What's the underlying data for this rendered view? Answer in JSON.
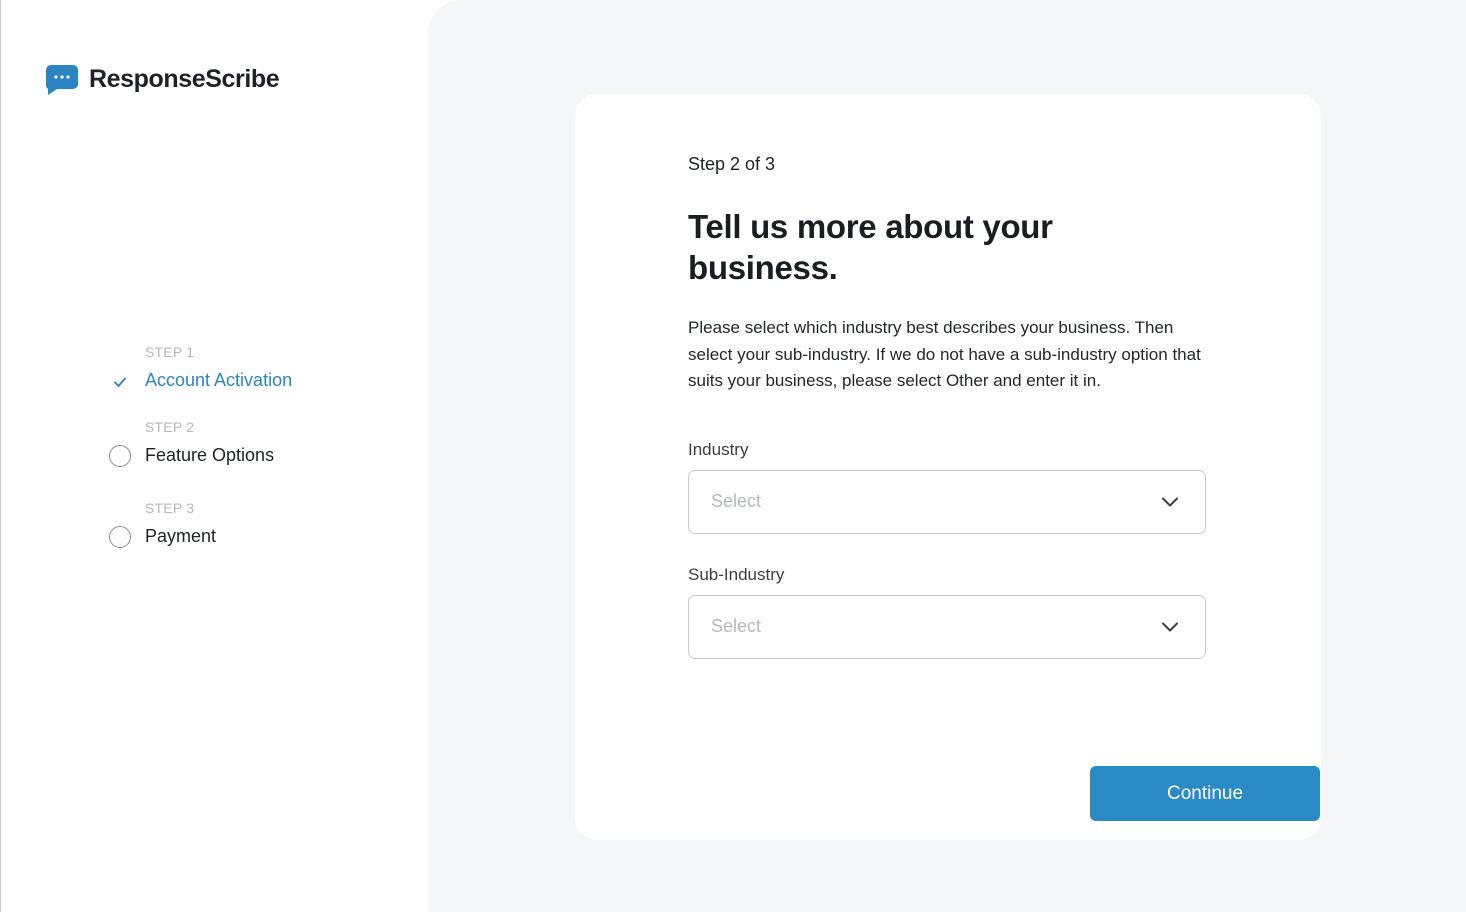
{
  "brand": {
    "name": "ResponseScribe",
    "accent": "#2a8ac6"
  },
  "steps": [
    {
      "label": "STEP 1",
      "title": "Account Activation",
      "status": "done"
    },
    {
      "label": "STEP 2",
      "title": "Feature Options",
      "status": "current"
    },
    {
      "label": "STEP 3",
      "title": "Payment",
      "status": "pending"
    }
  ],
  "form": {
    "step_count": "Step 2 of 3",
    "headline": "Tell us more about your business.",
    "description": "Please select which industry best describes your business. Then select your sub-industry. If we do not have a sub-industry option that suits your business, please select Other and enter it in.",
    "industry": {
      "label": "Industry",
      "placeholder": "Select"
    },
    "sub_industry": {
      "label": "Sub-Industry",
      "placeholder": "Select"
    },
    "continue_label": "Continue"
  }
}
